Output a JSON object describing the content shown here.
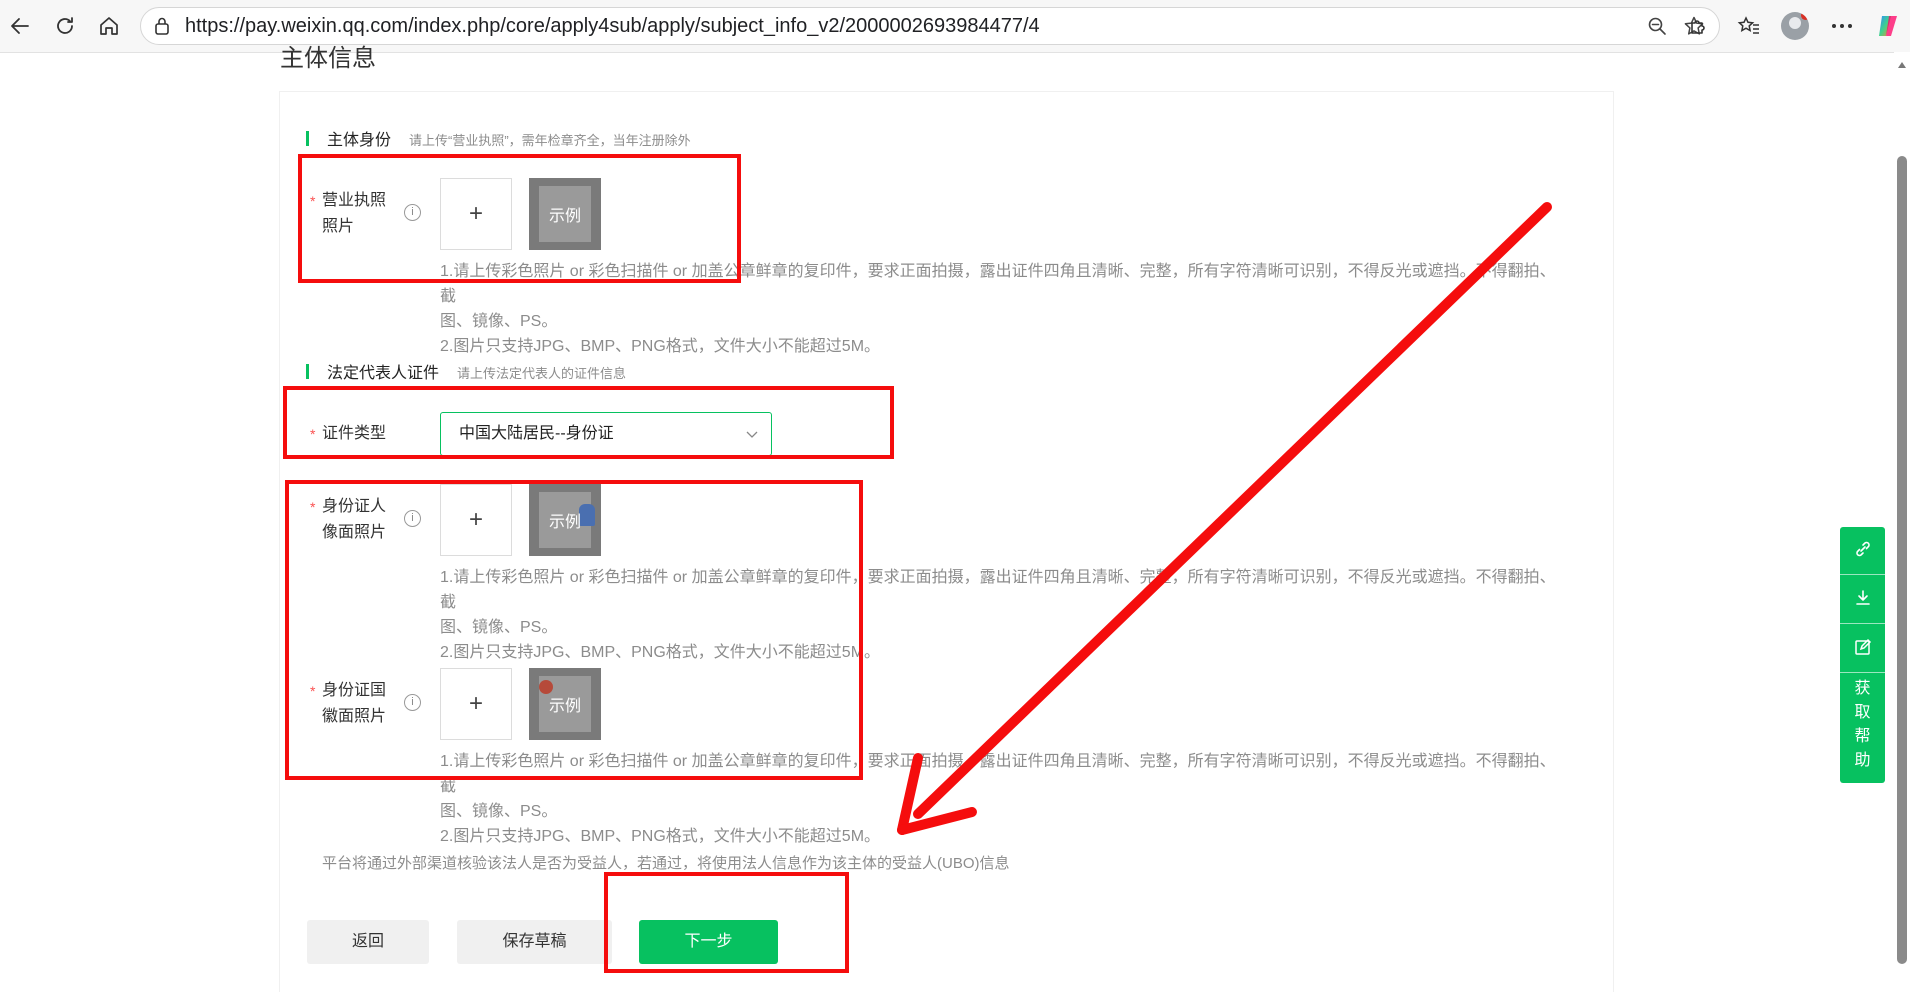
{
  "browser": {
    "url": "https://pay.weixin.qq.com/index.php/core/apply4sub/apply/subject_info_v2/2000002693984477/4"
  },
  "page": {
    "title": "主体信息"
  },
  "section_subject": {
    "title": "主体身份",
    "desc": "请上传“营业执照”，需年检章齐全，当年注册除外"
  },
  "license": {
    "label_line1": "营业执照",
    "label_line2": "照片",
    "required": "*",
    "upload_plus": "+",
    "sample_label": "示例",
    "hint_line1": "1.请上传彩色照片 or 彩色扫描件 or 加盖公章鲜章的复印件，要求正面拍摄，露出证件四角且清晰、完整，所有字符清晰可识别，不得反光或遮挡。不得翻拍、截",
    "hint_line2": "图、镜像、PS。",
    "hint_line3": "2.图片只支持JPG、BMP、PNG格式，文件大小不能超过5M。"
  },
  "section_legal": {
    "title": "法定代表人证件",
    "desc": "请上传法定代表人的证件信息"
  },
  "cert_type": {
    "label": "证件类型",
    "required": "*",
    "value": "中国大陆居民--身份证"
  },
  "id_front": {
    "label_line1": "身份证人",
    "label_line2": "像面照片",
    "required": "*",
    "upload_plus": "+",
    "sample_label": "示例",
    "hint_line1": "1.请上传彩色照片 or 彩色扫描件 or 加盖公章鲜章的复印件，要求正面拍摄，露出证件四角且清晰、完整，所有字符清晰可识别，不得反光或遮挡。不得翻拍、截",
    "hint_line2": "图、镜像、PS。",
    "hint_line3": "2.图片只支持JPG、BMP、PNG格式，文件大小不能超过5M。"
  },
  "id_back": {
    "label_line1": "身份证国",
    "label_line2": "徽面照片",
    "required": "*",
    "upload_plus": "+",
    "sample_label": "示例",
    "hint_line1": "1.请上传彩色照片 or 彩色扫描件 or 加盖公章鲜章的复印件，要求正面拍摄，露出证件四角且清晰、完整，所有字符清晰可识别，不得反光或遮挡。不得翻拍、截",
    "hint_line2": "图、镜像、PS。",
    "hint_line3": "2.图片只支持JPG、BMP、PNG格式，文件大小不能超过5M。"
  },
  "ubo_note": "平台将通过外部渠道核验该法人是否为受益人，若通过，将使用法人信息作为该主体的受益人(UBO)信息",
  "actions": {
    "back": "返回",
    "save_draft": "保存草稿",
    "next": "下一步"
  },
  "float_widget": {
    "help": [
      "获",
      "取",
      "帮",
      "助"
    ]
  },
  "colors": {
    "brand_green": "#07c160",
    "annotation_red": "#f50d0d",
    "required_red": "#fa5151"
  },
  "icons": [
    "back-arrow-icon",
    "reload-icon",
    "home-icon",
    "lock-icon",
    "zoom-out-icon",
    "star-icon",
    "extensions-icon",
    "favorites-icon",
    "more-icon",
    "copilot-icon",
    "link-icon",
    "download-icon",
    "edit-icon",
    "info-icon",
    "chevron-down-icon"
  ]
}
